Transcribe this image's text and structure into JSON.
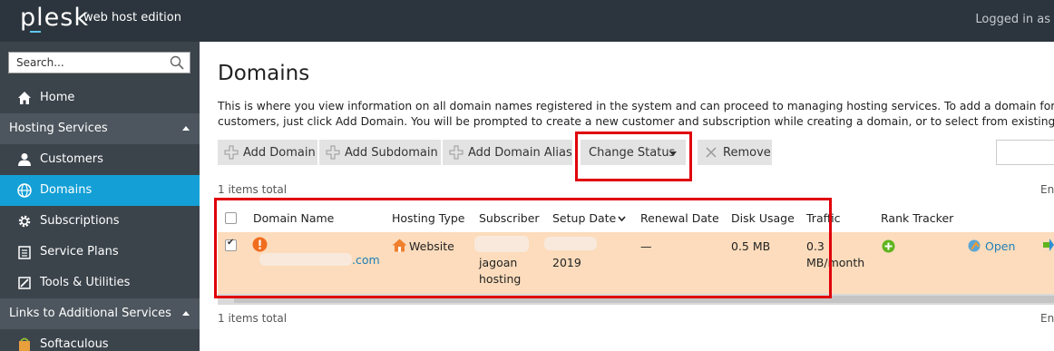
{
  "header": {
    "logo": "plesk",
    "edition": "web host edition",
    "logged_in": "Logged in as"
  },
  "sidebar": {
    "search_placeholder": "Search...",
    "home": "Home",
    "hosting_services": "Hosting Services",
    "items": [
      {
        "label": "Customers"
      },
      {
        "label": "Domains"
      },
      {
        "label": "Subscriptions"
      },
      {
        "label": "Service Plans"
      },
      {
        "label": "Tools & Utilities"
      }
    ],
    "links_section": "Links to Additional Services",
    "softaculous": "Softaculous"
  },
  "main": {
    "title": "Domains",
    "description_line1": "This is where you view information on all domain names registered in the system and can proceed to managing hosting services. To add a domain for yo",
    "description_line2": "customers, just click Add Domain. You will be prompted to create a new customer and subscription while creating a domain, or to select from existing on",
    "toolbar": {
      "add_domain": "Add Domain",
      "add_subdomain": "Add Subdomain",
      "add_domain_alias": "Add Domain Alias",
      "change_status": "Change Status",
      "remove": "Remove"
    },
    "items_total": "1 items total",
    "entries_label": "En",
    "columns": [
      "Domain Name",
      "Hosting Type",
      "Subscriber",
      "Setup Date",
      "Renewal Date",
      "Disk Usage",
      "Traffic",
      "Rank Tracker"
    ],
    "row": {
      "domain_suffix": ".com",
      "hosting_type": "Website",
      "subscriber_line1": "jagoan",
      "subscriber_line2": "hosting",
      "setup_date": "2019",
      "renewal_date": "—",
      "disk_usage": "0.5 MB",
      "traffic_line1": "0.3",
      "traffic_line2": "MB/month",
      "open_label": "Open"
    }
  },
  "colors": {
    "topbar": "#2c353d",
    "sidebar": "#3b434b",
    "active": "#14a0d6",
    "row_selected": "#fcdcbc",
    "annotation": "#e0000b"
  }
}
